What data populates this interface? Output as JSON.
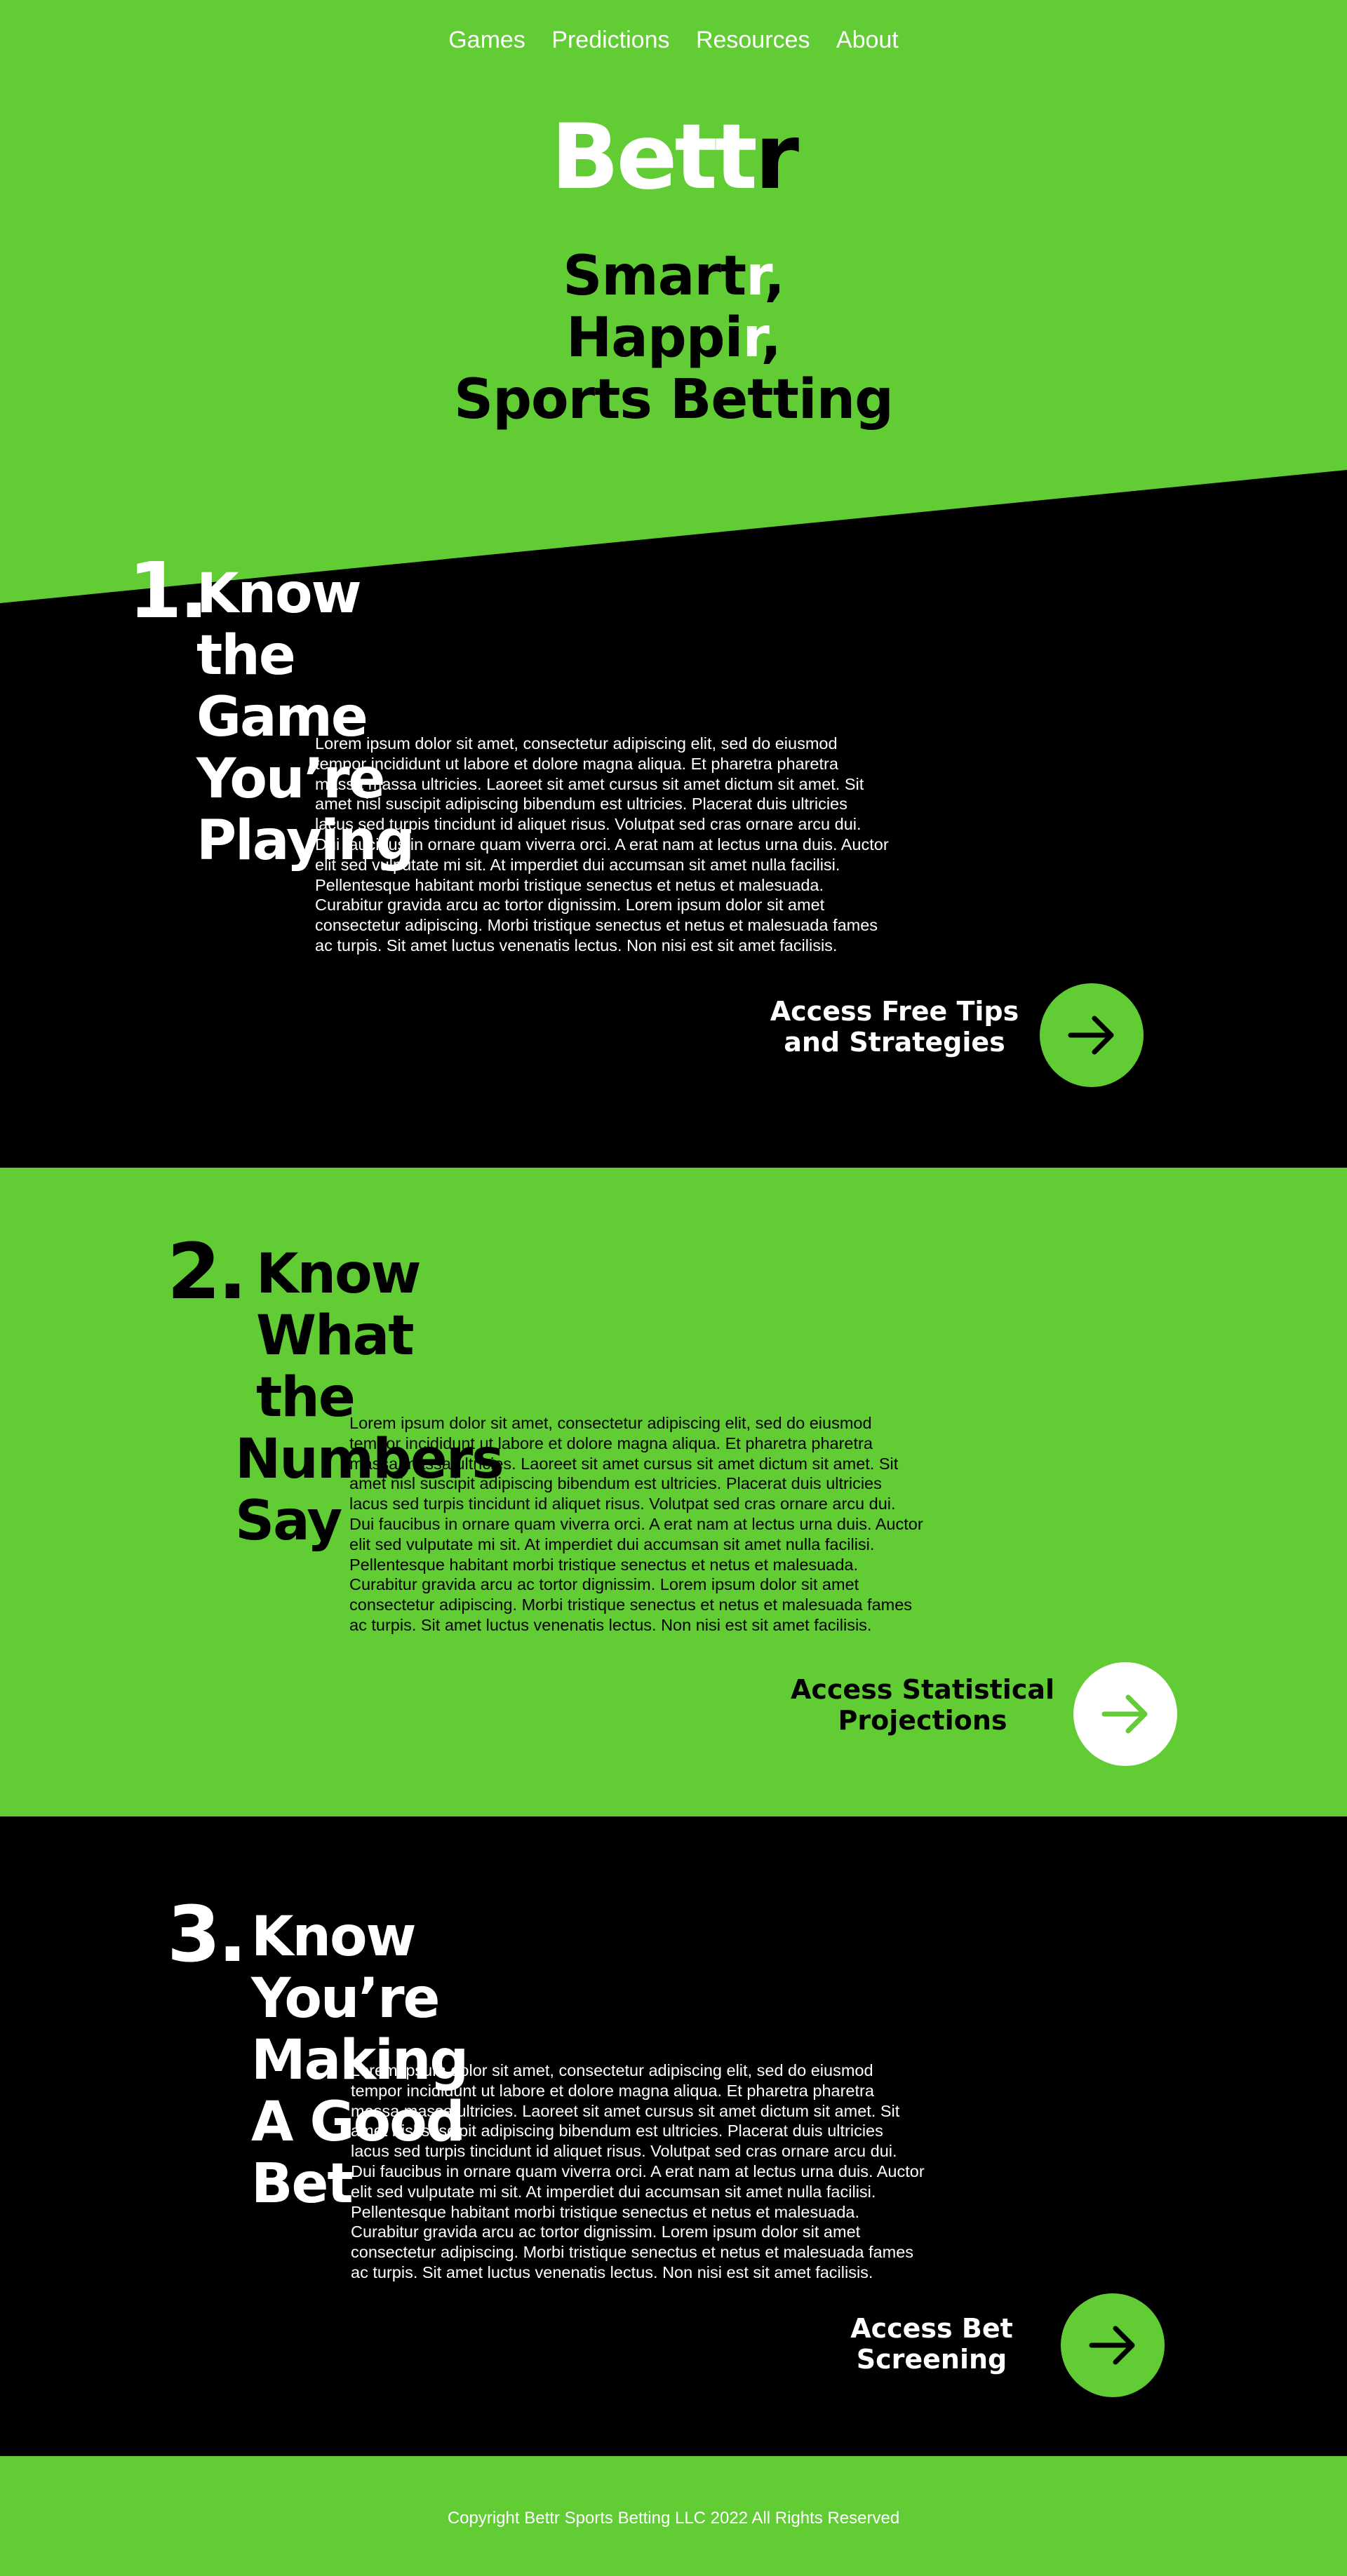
{
  "nav": {
    "items": [
      "Games",
      "Predictions",
      "Resources",
      "About"
    ]
  },
  "logo": {
    "part1": "Bett",
    "part2": "r"
  },
  "tagline": {
    "line1_a": "Smart",
    "line1_b": "r",
    "line1_c": ",",
    "line2_a": "Happi",
    "line2_b": "r",
    "line2_c": ",",
    "line3": "Sports Betting"
  },
  "sections": [
    {
      "number": "1.",
      "title_line1": "Know the Game",
      "title_line2": "You’re Playing",
      "body": "Lorem ipsum dolor sit amet, consectetur adipiscing elit, sed do eiusmod tempor incididunt ut labore et dolore magna aliqua. Et pharetra pharetra massa massa ultricies. Laoreet sit amet cursus sit amet dictum sit amet. Sit amet nisl suscipit adipiscing bibendum est ultricies. Placerat duis ultricies lacus sed turpis tincidunt id aliquet risus. Volutpat sed cras ornare arcu dui. Dui faucibus in ornare quam viverra orci. A erat nam at lectus urna duis. Auctor elit sed vulputate mi sit. At imperdiet dui accumsan sit amet nulla facilisi. Pellentesque habitant morbi tristique senectus et netus et malesuada. Curabitur gravida arcu ac tortor dignissim. Lorem ipsum dolor sit amet consectetur adipiscing. Morbi tristique senectus et netus et malesuada fames ac turpis. Sit amet luctus venenatis lectus. Non nisi est sit amet facilisis.",
      "cta_line1": "Access Free Tips",
      "cta_line2": "and Strategies",
      "button_icon": "arrow-right-icon"
    },
    {
      "number": "2.",
      "title_line1": "Know What the",
      "title_line2": "Numbers Say",
      "body": "Lorem ipsum dolor sit amet, consectetur adipiscing elit, sed do eiusmod tempor incididunt ut labore et dolore magna aliqua. Et pharetra pharetra massa massa ultricies. Laoreet sit amet cursus sit amet dictum sit amet. Sit amet nisl suscipit adipiscing bibendum est ultricies. Placerat duis ultricies lacus sed turpis tincidunt id aliquet risus. Volutpat sed cras ornare arcu dui. Dui faucibus in ornare quam viverra orci. A erat nam at lectus urna duis. Auctor elit sed vulputate mi sit. At imperdiet dui accumsan sit amet nulla facilisi. Pellentesque habitant morbi tristique senectus et netus et malesuada. Curabitur gravida arcu ac tortor dignissim. Lorem ipsum dolor sit amet consectetur adipiscing. Morbi tristique senectus et netus et malesuada fames ac turpis. Sit amet luctus venenatis lectus. Non nisi est sit amet facilisis.",
      "cta_line1": "Access Statistical",
      "cta_line2": "Projections",
      "button_icon": "arrow-right-icon"
    },
    {
      "number": "3.",
      "title_line1": "Know You’re Making",
      "title_line2": "A Good Bet",
      "body": "Lorem ipsum dolor sit amet, consectetur adipiscing elit, sed do eiusmod tempor incididunt ut labore et dolore magna aliqua. Et pharetra pharetra massa massa ultricies. Laoreet sit amet cursus sit amet dictum sit amet. Sit amet nisl suscipit adipiscing bibendum est ultricies. Placerat duis ultricies lacus sed turpis tincidunt id aliquet risus. Volutpat sed cras ornare arcu dui. Dui faucibus in ornare quam viverra orci. A erat nam at lectus urna duis. Auctor elit sed vulputate mi sit. At imperdiet dui accumsan sit amet nulla facilisi. Pellentesque habitant morbi tristique senectus et netus et malesuada. Curabitur gravida arcu ac tortor dignissim. Lorem ipsum dolor sit amet consectetur adipiscing. Morbi tristique senectus et netus et malesuada fames ac turpis. Sit amet luctus venenatis lectus. Non nisi est sit amet facilisis.",
      "cta_line1": "Access Bet",
      "cta_line2": "Screening",
      "button_icon": "arrow-right-icon"
    }
  ],
  "footer": {
    "copyright": "Copyright Bettr Sports Betting LLC 2022 All Rights Reserved"
  },
  "colors": {
    "brand_green": "#62CC35",
    "black": "#000000",
    "white": "#FFFFFF"
  }
}
